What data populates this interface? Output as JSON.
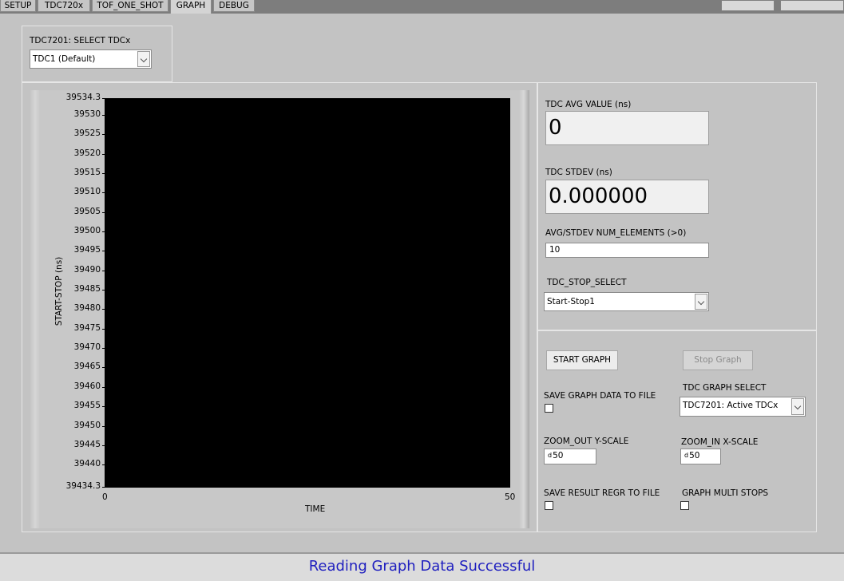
{
  "tabs": [
    {
      "label": "SETUP",
      "active": false
    },
    {
      "label": "TDC720x",
      "active": false
    },
    {
      "label": "TOF_ONE_SHOT",
      "active": false
    },
    {
      "label": "GRAPH",
      "active": true
    },
    {
      "label": "DEBUG",
      "active": false
    }
  ],
  "tdc_select": {
    "label": "TDC7201: SELECT TDCx",
    "value": "TDC1 (Default)"
  },
  "results": {
    "avg_label": "TDC AVG VALUE (ns)",
    "avg_value": "0",
    "stdev_label": "TDC STDEV (ns)",
    "stdev_value": "0.000000",
    "num_elements_label": "AVG/STDEV NUM_ELEMENTS (>0)",
    "num_elements_value": "10",
    "stop_select_label": "TDC_STOP_SELECT",
    "stop_select_value": "Start-Stop1"
  },
  "controls": {
    "start_graph": "START GRAPH",
    "stop_graph": "Stop Graph",
    "save_graph_label": "SAVE GRAPH DATA TO FILE",
    "graph_select_label": "TDC GRAPH SELECT",
    "graph_select_value": "TDC7201: Active TDCx",
    "zoom_out_label": "ZOOM_OUT Y-SCALE",
    "zoom_out_value": "50",
    "zoom_in_label": "ZOOM_IN X-SCALE",
    "zoom_in_value": "50",
    "numeric_prefix": "d",
    "save_result_label": "SAVE RESULT REGR TO FILE",
    "graph_multi_label": "GRAPH MULTI STOPS"
  },
  "chart_data": {
    "type": "line",
    "xlabel": "TIME",
    "ylabel": "START-STOP (ns)",
    "xlim": [
      0,
      50
    ],
    "ylim": [
      39434.3,
      39534.3
    ],
    "x_ticks": [
      "0",
      "50"
    ],
    "y_ticks": [
      {
        "value": 39534.3,
        "label": "39534.3"
      },
      {
        "value": 39530,
        "label": "39530"
      },
      {
        "value": 39525,
        "label": "39525"
      },
      {
        "value": 39520,
        "label": "39520"
      },
      {
        "value": 39515,
        "label": "39515"
      },
      {
        "value": 39510,
        "label": "39510"
      },
      {
        "value": 39505,
        "label": "39505"
      },
      {
        "value": 39500,
        "label": "39500"
      },
      {
        "value": 39495,
        "label": "39495"
      },
      {
        "value": 39490,
        "label": "39490"
      },
      {
        "value": 39485,
        "label": "39485"
      },
      {
        "value": 39480,
        "label": "39480"
      },
      {
        "value": 39475,
        "label": "39475"
      },
      {
        "value": 39470,
        "label": "39470"
      },
      {
        "value": 39465,
        "label": "39465"
      },
      {
        "value": 39460,
        "label": "39460"
      },
      {
        "value": 39455,
        "label": "39455"
      },
      {
        "value": 39450,
        "label": "39450"
      },
      {
        "value": 39445,
        "label": "39445"
      },
      {
        "value": 39440,
        "label": "39440"
      },
      {
        "value": 39434.3,
        "label": "39434.3"
      }
    ],
    "series": [],
    "background": "#000000"
  },
  "status": {
    "message": "Reading Graph Data Successful",
    "color": "#1f1fbf"
  }
}
